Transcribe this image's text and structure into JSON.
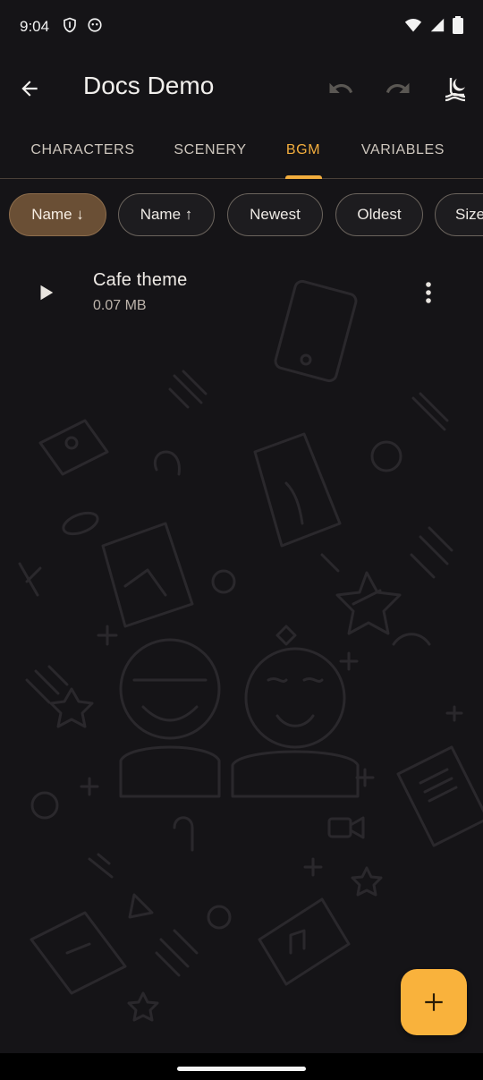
{
  "status_bar": {
    "time": "9:04"
  },
  "app_bar": {
    "title": "Docs Demo"
  },
  "tabs": [
    {
      "label": "CHARACTERS",
      "active": false
    },
    {
      "label": "SCENERY",
      "active": false
    },
    {
      "label": "BGM",
      "active": true
    },
    {
      "label": "VARIABLES",
      "active": false
    }
  ],
  "sort_chips": [
    {
      "label": "Name ↓",
      "selected": true
    },
    {
      "label": "Name ↑",
      "selected": false
    },
    {
      "label": "Newest",
      "selected": false
    },
    {
      "label": "Oldest",
      "selected": false
    },
    {
      "label": "Size",
      "selected": false
    }
  ],
  "items": [
    {
      "title": "Cafe theme",
      "subtitle": "0.07 MB"
    }
  ],
  "colors": {
    "accent": "#f2ad3d",
    "background": "#151417",
    "chip_selected": "#6a4f35",
    "fab": "#f9b23c"
  },
  "icons": {
    "back": "arrow-left-icon",
    "undo": "undo-icon",
    "redo": "redo-icon",
    "theme": "theme-mode-icon",
    "play": "play-icon",
    "more": "more-vertical-icon",
    "add": "plus-icon"
  }
}
